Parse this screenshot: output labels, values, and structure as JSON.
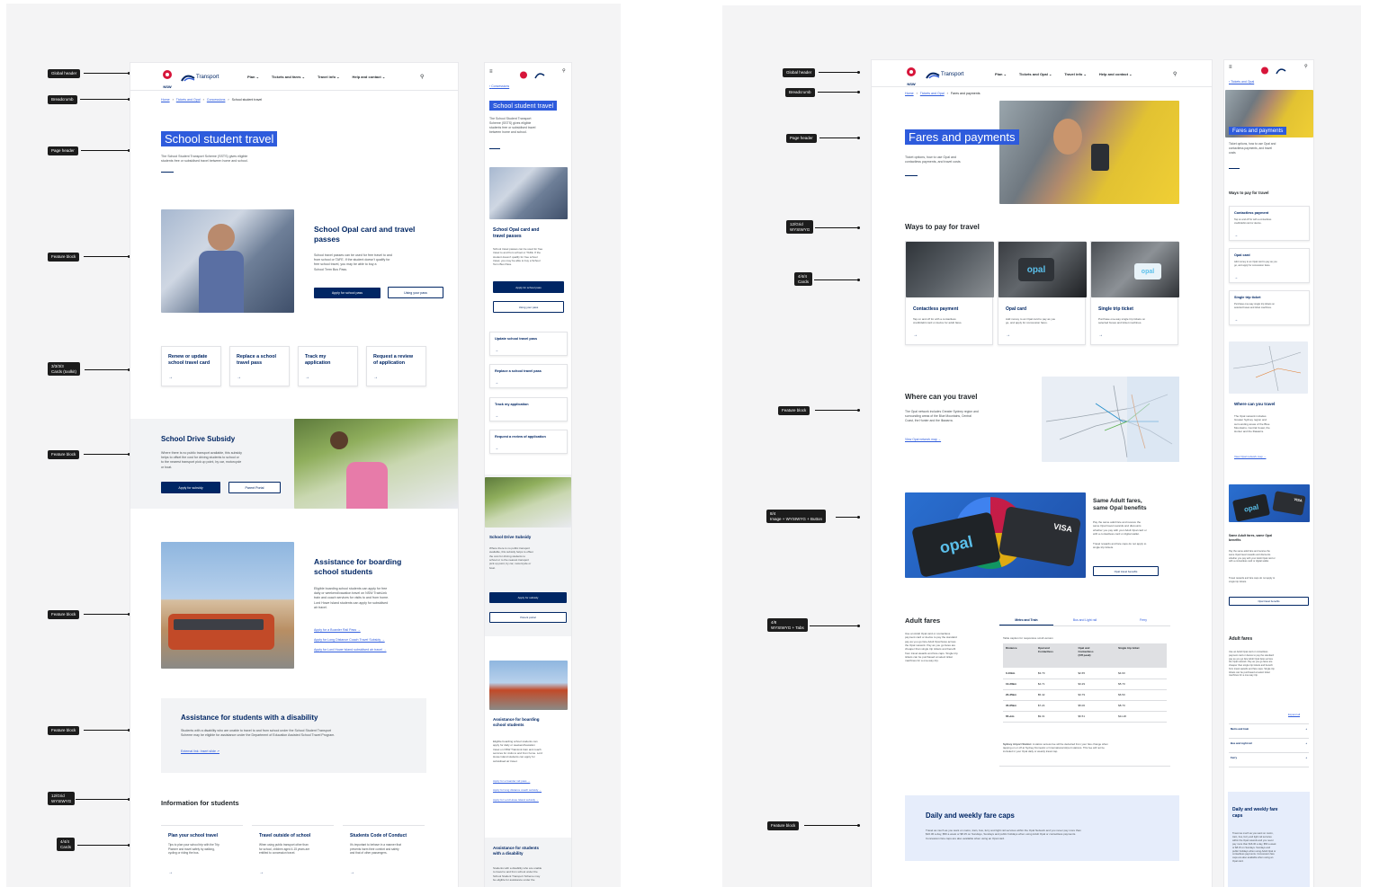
{
  "annotations_left": [
    {
      "id": "a1",
      "text": "Global header"
    },
    {
      "id": "a2",
      "text": "Breadcrumb"
    },
    {
      "id": "a3",
      "text": "Page header"
    },
    {
      "id": "a4",
      "text": "Feature block"
    },
    {
      "id": "a5",
      "text": "3/3/3/3\nCards (toolkit)"
    },
    {
      "id": "a6",
      "text": "Feature block"
    },
    {
      "id": "a7",
      "text": "Feature block"
    },
    {
      "id": "a8",
      "text": "Feature block"
    },
    {
      "id": "a9",
      "text": "12/Grid\nWYSIWYG"
    },
    {
      "id": "a10",
      "text": "4/4/4\nCards"
    }
  ],
  "annotations_right": [
    {
      "id": "b1",
      "text": "Global header"
    },
    {
      "id": "b2",
      "text": "Breadcrumb"
    },
    {
      "id": "b3",
      "text": "Page header"
    },
    {
      "id": "b4",
      "text": "12/Grid\nWYSIWYG"
    },
    {
      "id": "b5",
      "text": "4/4/4\nCards"
    },
    {
      "id": "b6",
      "text": "Feature block"
    },
    {
      "id": "b7",
      "text": "8/4\nImage + WYSIWYG + Button"
    },
    {
      "id": "b8",
      "text": "4/8\nWYSIWYG + Tabs"
    },
    {
      "id": "b9",
      "text": "Feature block"
    }
  ],
  "header": {
    "logo_text": "NSW",
    "brand": "Transport",
    "nav_left": [
      "Plan",
      "Tickets and fares",
      "Travel info",
      "Help and contact"
    ],
    "nav_right": [
      "Plan",
      "Tickets and Opal",
      "Travel info",
      "Help and contact"
    ],
    "search_icon": "search-icon",
    "menu_icon": "hamburger-icon"
  },
  "left": {
    "breadcrumb": [
      "Home",
      "Tickets and Opal",
      "Concessions",
      "School student travel"
    ],
    "mobile_back": "Concessions",
    "title": "School student travel",
    "intro": "The School Student Transport Scheme (SSTS) gives eligible\nstudents free or subsidised travel between home and school.",
    "mobile_intro": "The School Student Transport\nScheme (SSTS) gives eligible\nstudents free or subsidised travel\nbetween home and school.",
    "feature1": {
      "title": "School Opal card and travel\npasses",
      "mobile_title": "School Opal card and\ntravel passes",
      "body": "School travel passes can be used for free travel to and\nfrom school or TAFE. If the student doesn't qualify for\nfree school travel, you may be able to buy a\nSchool Term Bus Pass.",
      "mobile_body": "School travel passes can be used for free\ntravel to and from school or TAFE. If the\nstudent doesn't qualify for free school\ntravel, you may be able to buy a School\nTerm Bus Pass.",
      "primary": "Apply for school pass",
      "secondary": "Using your pass"
    },
    "cards": [
      "Renew or update\nschool travel card",
      "Replace a school\ntravel pass",
      "Track my\napplication",
      "Request a review\nof application"
    ],
    "mobile_cards": [
      "Update school travel pass",
      "Replace a school travel pass",
      "Track my application",
      "Request a review of application"
    ],
    "feature2": {
      "title": "School Drive Subsidy",
      "body": "Where there is no public transport available, this subsidy\nhelps to offset the cost for driving students to school or\nto the nearest transport pick up point, by car, motorcycle\nor boat.",
      "mobile_body": "Where there is no public transport\navailable, this subsidy helps to offset\nthe cost for driving students to\nschool or to the nearest transport\npick up point, by car, motorcycle or\nboat.",
      "primary": "Apply for subsidy",
      "secondary": "Parent Portal",
      "mobile_secondary": "Parent portal"
    },
    "feature3": {
      "title": "Assistance for boarding\nschool students",
      "body": "Eligible boarding school students can apply for free\ndaily or weekend/vacation travel on NSW TrainLink\ntrain and coach services for visits to and from home.\nLord Howe Island students can apply for subsidised\nair travel.",
      "mobile_body": "Eligible boarding school students can\napply for daily or weekend/vacation\ntravel on NSW TrainLink train and coach\nservices for visits to and from home. Lord\nHowe Island students can apply for\nsubsidised air travel.",
      "links": [
        "Apply for a Boarder Rail Pass →",
        "Apply for Long Distance Coach Travel Subsidy →",
        "Apply for Lord Howe Island subsidised air travel →"
      ],
      "mobile_links": [
        "Apply for a boarder  rail pass →",
        "Apply for long distance coach subsidy →",
        "Apply for Lord Howe Island subsidy →"
      ]
    },
    "feature4": {
      "title": "Assistance for students with a disability",
      "mobile_title": "Assistance for students\nwith a disability",
      "body": "Students with a disability who are unable to travel to and from school under the School Student Transport\nScheme may be eligible for assistance under the Department of Education Assisted School Travel Program.",
      "mobile_body": "Students with a disability who are unable\nto travel to and from school under the\nSchool Student Transport Scheme may\nbe eligible for assistance under the",
      "link": "External link: Insert slide ↗"
    },
    "info_title": "Information for students",
    "info_cards": [
      {
        "title": "Plan your school travel",
        "body": "Tips to plan your school trip with the Trip\nPlanner and travel safely by walking,\ncycling or riding the bus."
      },
      {
        "title": "Travel outside of school",
        "body": "When using public transport other than\nfor school, children aged 4-15 years are\nentitled to concession travel."
      },
      {
        "title": "Students Code of Conduct",
        "body": "It's important to behave in a manner that\nprevents harm their comfort and safety\nand that of other passengers."
      }
    ]
  },
  "right": {
    "breadcrumb": [
      "Home",
      "Tickets and Opal",
      "Fares and payments"
    ],
    "mobile_back": "Tickets and Opal",
    "title": "Fares and payments",
    "intro": "Ticket options, how to use Opal and\ncontactless payments, and travel costs",
    "mobile_intro": "Ticket options, how to use Opal and\ncontactless payments, and travel\ncosts",
    "ways_title": "Ways to pay for travel",
    "pay_cards": [
      {
        "title": "Contactless payment",
        "body": "Tap on and off for with a contactless\ncredit/debit card or device for adult fares."
      },
      {
        "title": "Opal card",
        "body": "Add money to an Opal card to pay as you\ngo, and apply for concession fares."
      },
      {
        "title": "Single trip ticket",
        "body": "Purchase one-way single trip tickets on\nselected buses and ticket machines."
      }
    ],
    "mobile_pay_cards": [
      {
        "title": "Contactless payment",
        "body": "Tap on and off for with a contactless\ncredit/debit card or device."
      },
      {
        "title": "Opal card",
        "body": "Add money to an Opal card to pay as you\ngo, and apply for concession fares."
      },
      {
        "title": "Single trip ticket",
        "body": "Purchase one-way single trip tickets on\nselected buses and ticket machines."
      }
    ],
    "where": {
      "title": "Where can you travel",
      "body": "The Opal network includes Greater Sydney region and\nsurrounding areas of the Blue Mountains, Central\nCoast, the Hunter and the Illawarra.",
      "mobile_body": "The Opal network includes\nGreater Sydney region and\nsurrounding areas of the Blue\nMountains, Central Coast, the\nHunter and the Illawarra.",
      "link": "View Opal network map →"
    },
    "same": {
      "title": "Same Adult fares,\nsame Opal benefits",
      "mobile_title": "Same Adult fares, same Opal\nbenefits",
      "body": "Pay the same adult fare and receive the\nsame Opal travel rewards and discounts\nwhether you pay with your Adult Opal card or\nwith a contactless card or digital wallet.",
      "body2": "Travel rewards and fare caps do not apply to\nsingle trip tickets.",
      "button": "Opal travel benefits",
      "opal_text": "opal",
      "visa_text": "VISA"
    },
    "adult": {
      "title": "Adult fares",
      "body": "Use an Adult Opal card or contactless\npayment card or device to pay the standard\npay as you go fare Adult Opal fares across\nthe Opal network. Pay as you go fares are\ncheaper than single trip tickets and benefit\nfrom travel awards and fare caps. Single trip\ntickets can be purchased at select ticket\nmachines for a one-way trip.",
      "tabs": [
        "Metro and Train",
        "Bus and Light rail",
        "Ferry"
      ],
      "caption": "Table caption for responsive scroll version",
      "columns": [
        "Distance",
        "Opal and\nContactless",
        "Opal and\nContactless\n(Off peak)",
        "Single trip ticket"
      ],
      "rows": [
        [
          "0-10km",
          "$3.79",
          "$2.65",
          "$4.60"
        ],
        [
          "10-20km",
          "$4.71",
          "$3.29",
          "$5.70"
        ],
        [
          "20-35km",
          "$5.42",
          "$3.79",
          "$6.50"
        ],
        [
          "35-65km",
          "$7.24",
          "$5.06",
          "$8.70"
        ],
        [
          "65+km",
          "$9.31",
          "$6.51",
          "$11.20"
        ]
      ],
      "note_bold": "Sydney Airport Station:",
      "note": " A station access fee will be deducted from your fare change when\ntapping on or off at Sydney Domestic or International Airport stations. This fee will not be\nincluded in your Opal daily or weekly travel cap.",
      "expand": "Expand all",
      "accordion": [
        "Metro and train",
        "Bus and Light rail",
        "Ferry"
      ]
    },
    "caps": {
      "title": "Daily and weekly fare caps",
      "mobile_title": "Daily and weekly fare\ncaps",
      "body": "Travel as much as you want on metro, train, bus, ferry and light rail services within the Opal Network and you never pay more than\n$16.30 a day, $50 a week or $8.15 on Sundays, Sundays and public holidays when using Adult Opal or contactless payments.\nConcession fare caps are also available when using an Opal card.",
      "mobile_body": "Travel as much as you want on metro,\ntrain, bus, ferry and light rail services\nwithin the Opal network and you never\npay more than $16.30 a day, $50 a week\nor $8.15 on Sundays. Sundays and\npublic holidays when using Adult Opal or\ncontactless payments. Concession fare\ncaps are also available when using an\nOpal card."
    }
  },
  "colors": {
    "navy": "#002664",
    "accent_blue": "#2e5bdc",
    "annotation_bg": "#1c1c1c"
  }
}
